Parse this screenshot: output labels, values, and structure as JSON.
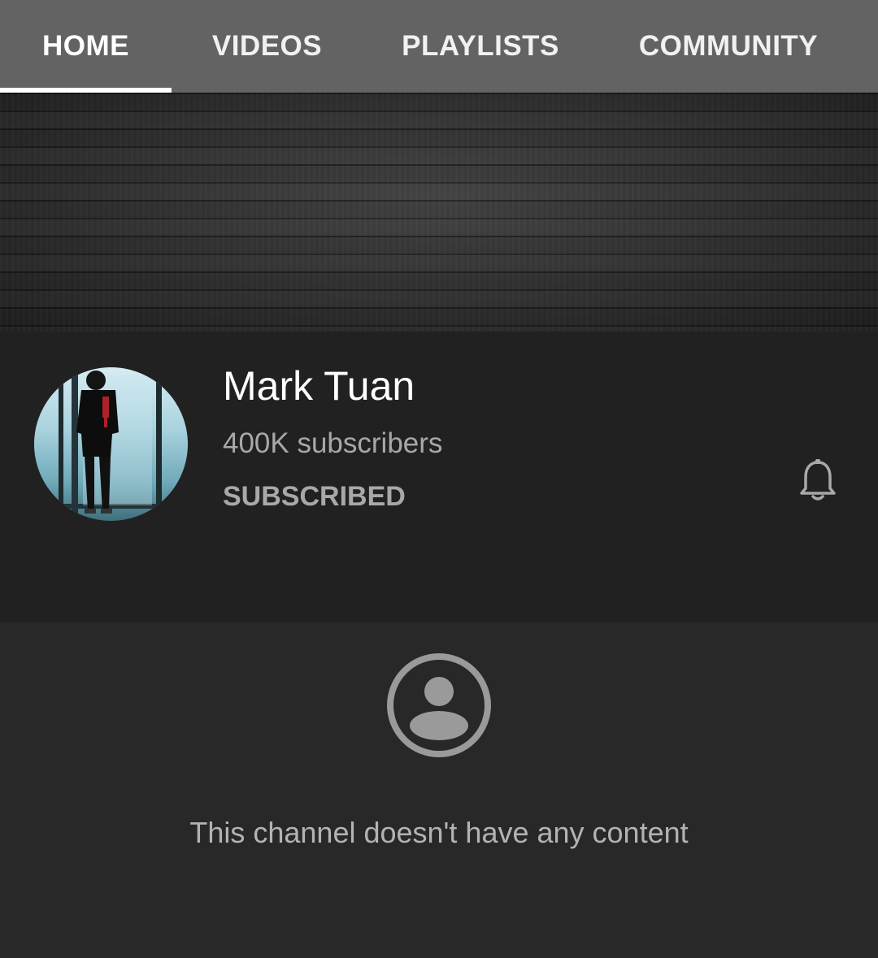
{
  "tabs": [
    {
      "label": "HOME",
      "active": true
    },
    {
      "label": "VIDEOS",
      "active": false
    },
    {
      "label": "PLAYLISTS",
      "active": false
    },
    {
      "label": "COMMUNITY",
      "active": false
    }
  ],
  "channel": {
    "name": "Mark Tuan",
    "subscribers": "400K subscribers",
    "subscribe_state": "SUBSCRIBED",
    "avatar_icon": "channel-avatar-photo",
    "notifications_icon": "bell-icon"
  },
  "empty_state": {
    "icon": "account-circle-icon",
    "message": "This channel doesn't have any content"
  },
  "colors": {
    "tab_bar": "#636363",
    "tab_indicator": "#ffffff",
    "header_bg": "#212121",
    "page_bg": "#282828",
    "secondary_text": "#a8a8a8"
  }
}
